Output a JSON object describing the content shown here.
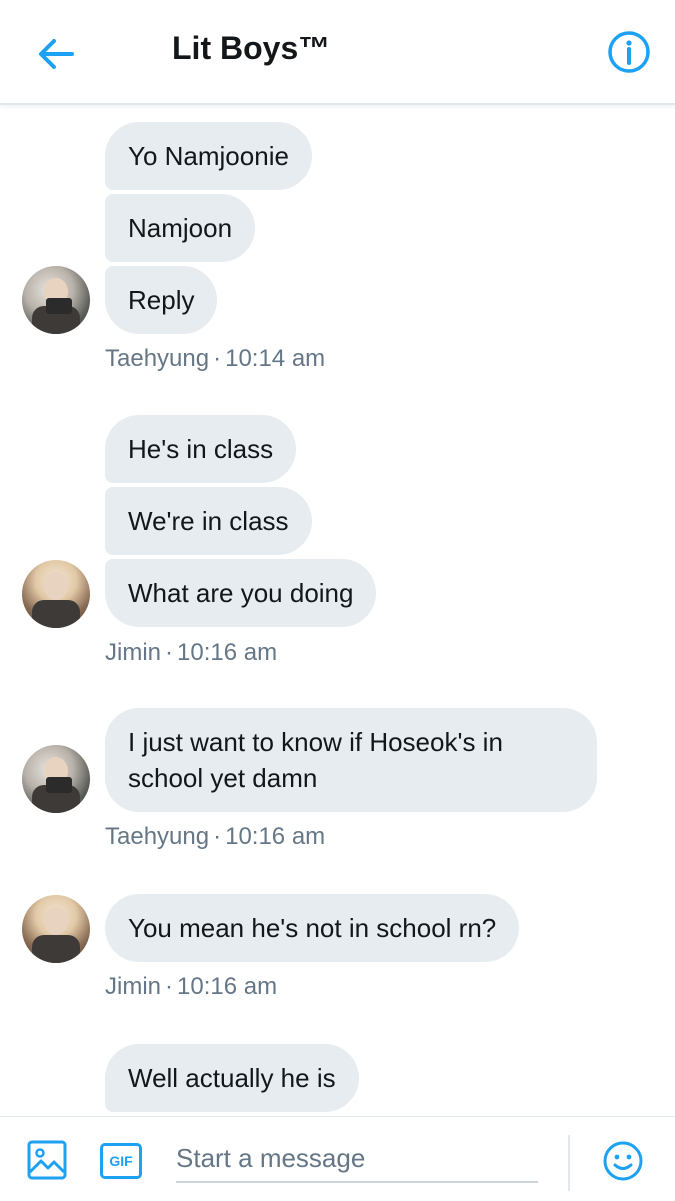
{
  "header": {
    "title": "Lit Boys™",
    "back_icon": "arrow-left-icon",
    "info_icon": "info-circle-icon",
    "accent_color": "#1da1f2"
  },
  "messages": [
    {
      "sender": "Taehyung",
      "time": "10:14 am",
      "texts": [
        "Yo Namjoonie",
        "Namjoon",
        "Reply"
      ]
    },
    {
      "sender": "Jimin",
      "time": "10:16 am",
      "texts": [
        "He's in class",
        "We're in class",
        "What are you doing"
      ]
    },
    {
      "sender": "Taehyung",
      "time": "10:16 am",
      "texts": [
        "I just want to know if Hoseok's in school yet damn"
      ]
    },
    {
      "sender": "Jimin",
      "time": "10:16 am",
      "texts": [
        "You mean he's not in school rn?"
      ]
    },
    {
      "sender": "",
      "time": "",
      "texts": [
        "Well actually he is"
      ]
    }
  ],
  "composer": {
    "placeholder": "Start a message",
    "gif_label": "GIF",
    "image_icon": "image-icon",
    "emoji_icon": "smiley-icon"
  },
  "colors": {
    "bubble_bg": "#e6ecf0",
    "meta_text": "#657786"
  }
}
